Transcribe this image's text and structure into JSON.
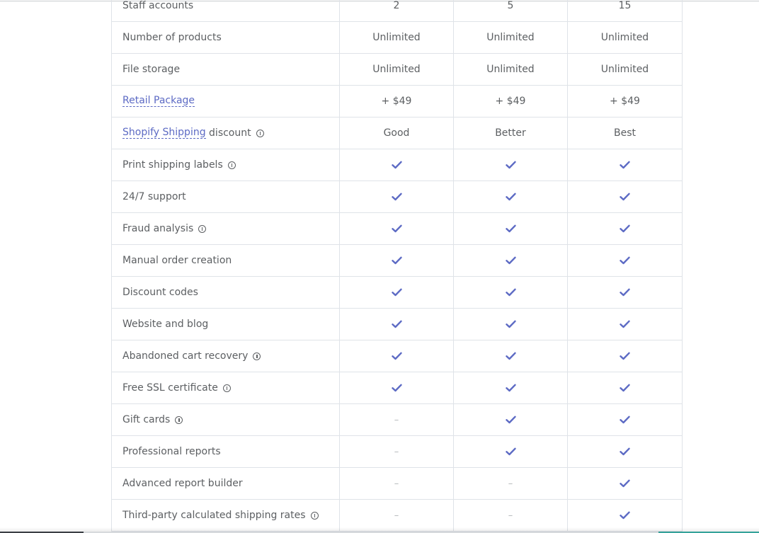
{
  "rows": [
    {
      "label": "Staff accounts",
      "link": "",
      "suffix": "",
      "info": false,
      "values": [
        {
          "t": "text",
          "v": "2"
        },
        {
          "t": "text",
          "v": "5"
        },
        {
          "t": "text",
          "v": "15"
        }
      ]
    },
    {
      "label": "Number of products",
      "link": "",
      "suffix": "",
      "info": false,
      "values": [
        {
          "t": "text",
          "v": "Unlimited"
        },
        {
          "t": "text",
          "v": "Unlimited"
        },
        {
          "t": "text",
          "v": "Unlimited"
        }
      ]
    },
    {
      "label": "File storage",
      "link": "",
      "suffix": "",
      "info": false,
      "values": [
        {
          "t": "text",
          "v": "Unlimited"
        },
        {
          "t": "text",
          "v": "Unlimited"
        },
        {
          "t": "text",
          "v": "Unlimited"
        }
      ]
    },
    {
      "label": "",
      "link": "Retail Package",
      "suffix": "",
      "info": false,
      "values": [
        {
          "t": "text",
          "v": "+ $49"
        },
        {
          "t": "text",
          "v": "+ $49"
        },
        {
          "t": "text",
          "v": "+ $49"
        }
      ]
    },
    {
      "label": "",
      "link": "Shopify Shipping",
      "suffix": " discount",
      "info": true,
      "values": [
        {
          "t": "text",
          "v": "Good"
        },
        {
          "t": "text",
          "v": "Better"
        },
        {
          "t": "text",
          "v": "Best"
        }
      ]
    },
    {
      "label": "Print shipping labels",
      "link": "",
      "suffix": "",
      "info": true,
      "values": [
        {
          "t": "check"
        },
        {
          "t": "check"
        },
        {
          "t": "check"
        }
      ]
    },
    {
      "label": "24/7 support",
      "link": "",
      "suffix": "",
      "info": false,
      "values": [
        {
          "t": "check"
        },
        {
          "t": "check"
        },
        {
          "t": "check"
        }
      ]
    },
    {
      "label": "Fraud analysis",
      "link": "",
      "suffix": "",
      "info": true,
      "values": [
        {
          "t": "check"
        },
        {
          "t": "check"
        },
        {
          "t": "check"
        }
      ]
    },
    {
      "label": "Manual order creation",
      "link": "",
      "suffix": "",
      "info": false,
      "values": [
        {
          "t": "check"
        },
        {
          "t": "check"
        },
        {
          "t": "check"
        }
      ]
    },
    {
      "label": "Discount codes",
      "link": "",
      "suffix": "",
      "info": false,
      "values": [
        {
          "t": "check"
        },
        {
          "t": "check"
        },
        {
          "t": "check"
        }
      ]
    },
    {
      "label": "Website and blog",
      "link": "",
      "suffix": "",
      "info": false,
      "values": [
        {
          "t": "check"
        },
        {
          "t": "check"
        },
        {
          "t": "check"
        }
      ]
    },
    {
      "label": "Abandoned cart recovery",
      "link": "",
      "suffix": "",
      "info": true,
      "values": [
        {
          "t": "check"
        },
        {
          "t": "check"
        },
        {
          "t": "check"
        }
      ]
    },
    {
      "label": "Free SSL certificate",
      "link": "",
      "suffix": "",
      "info": true,
      "values": [
        {
          "t": "check"
        },
        {
          "t": "check"
        },
        {
          "t": "check"
        }
      ]
    },
    {
      "label": "Gift cards",
      "link": "",
      "suffix": "",
      "info": true,
      "values": [
        {
          "t": "dash",
          "v": "–"
        },
        {
          "t": "check"
        },
        {
          "t": "check"
        }
      ]
    },
    {
      "label": "Professional reports",
      "link": "",
      "suffix": "",
      "info": false,
      "values": [
        {
          "t": "dash",
          "v": "–"
        },
        {
          "t": "check"
        },
        {
          "t": "check"
        }
      ]
    },
    {
      "label": "Advanced report builder",
      "link": "",
      "suffix": "",
      "info": false,
      "values": [
        {
          "t": "dash",
          "v": "–"
        },
        {
          "t": "dash",
          "v": "–"
        },
        {
          "t": "check"
        }
      ]
    },
    {
      "label": "Third-party calculated shipping rates",
      "link": "",
      "suffix": "",
      "info": true,
      "values": [
        {
          "t": "dash",
          "v": "–"
        },
        {
          "t": "dash",
          "v": "–"
        },
        {
          "t": "check"
        }
      ]
    }
  ],
  "colors": {
    "check": "#5c6ac4",
    "link": "#5c6ac4",
    "text": "#5c5f62",
    "border": "#dfe3e8"
  },
  "icons": {
    "check": "checkmark-icon",
    "info": "info-icon"
  }
}
